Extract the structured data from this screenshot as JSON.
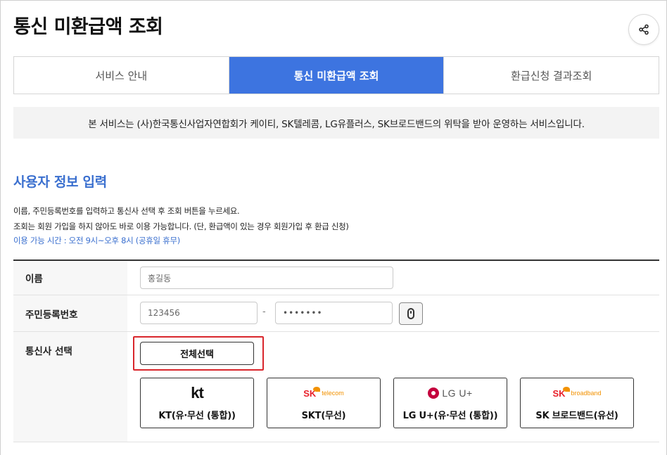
{
  "header": {
    "title": "통신 미환급액 조회",
    "share_icon": "share-icon"
  },
  "tabs": [
    {
      "label": "서비스 안내",
      "active": false
    },
    {
      "label": "통신 미환급액 조회",
      "active": true
    },
    {
      "label": "환급신청 결과조회",
      "active": false
    }
  ],
  "notice": "본 서비스는 (사)한국통신사업자연합회가 케이티, SK텔레콤, LG유플러스, SK브로드밴드의 위탁을 받아 운영하는 서비스입니다.",
  "section": {
    "title": "사용자 정보 입력",
    "desc1": "이름, 주민등록번호를 입력하고 통신사 선택 후 조회 버튼을 누르세요.",
    "desc2": "조회는 회원 가입을 하지 않아도 바로 이용 가능합니다. (단, 환급액이 있는 경우 회원가입 후 환급 신청)",
    "hours": "이용 가능 시간 : 오전 9시~오후 8시 (공휴일 휴무)"
  },
  "form": {
    "name_label": "이름",
    "name_value": "홍길동",
    "rrn_label": "주민등록번호",
    "rrn_front": "123456",
    "rrn_separator": "-",
    "rrn_back": "•••••••",
    "carrier_label": "통신사 선택",
    "select_all": "전체선택",
    "carriers": [
      {
        "logo_text": "kt",
        "name": "KT(유·무선 (통합))"
      },
      {
        "logo_text": "SK",
        "logo_sub": "telecom",
        "name": "SKT(무선)"
      },
      {
        "logo_text": "LG U+",
        "name": "LG U+(유·무선 (통합))"
      },
      {
        "logo_text": "SK",
        "logo_sub": "broadband",
        "name": "SK 브로드밴드(유선)"
      }
    ]
  },
  "colors": {
    "accent": "#3d74e0",
    "section_title": "#3a6fcf",
    "highlight": "#d9262c"
  }
}
